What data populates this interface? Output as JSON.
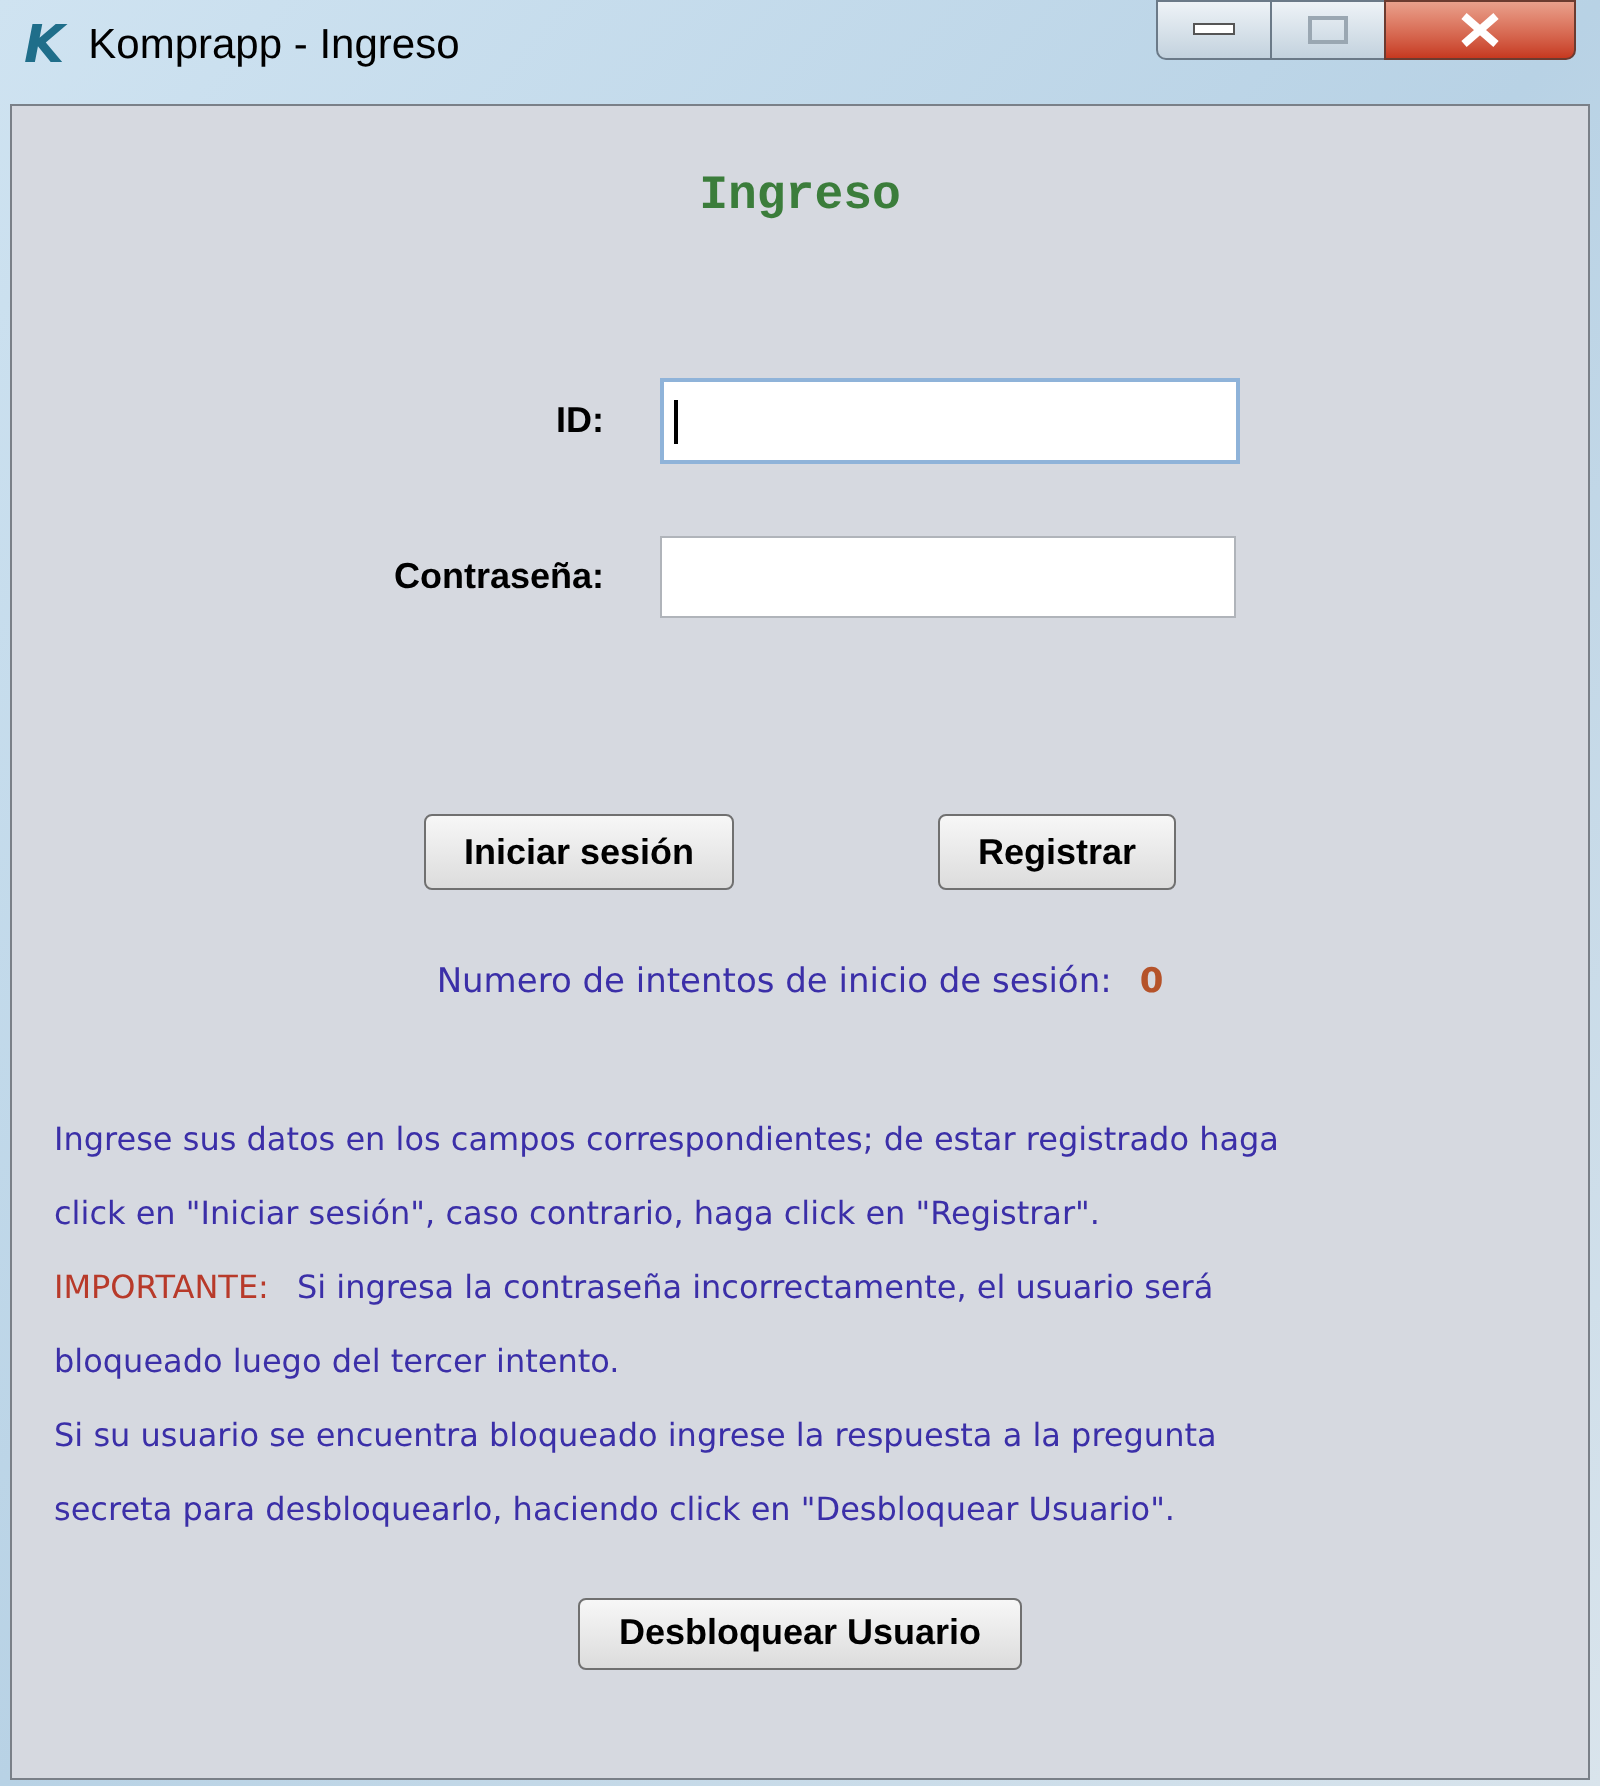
{
  "window": {
    "title": "Komprapp - Ingreso",
    "app_letter": "K"
  },
  "heading": "Ingreso",
  "fields": [
    {
      "label": "ID:",
      "focused": true
    },
    {
      "label": "Contraseña:",
      "focused": false
    }
  ],
  "buttons": [
    "Iniciar sesión",
    "Registrar"
  ],
  "attempts": {
    "label": "Numero de intentos de inicio de sesión:",
    "count": "0"
  },
  "info_lines": [
    {
      "kind": "plain",
      "text": "Ingrese sus datos en los campos correspondientes; de estar registrado haga"
    },
    {
      "kind": "plain",
      "text": "click en \"Iniciar sesión\", caso contrario, haga click en \"Registrar\"."
    },
    {
      "kind": "warning",
      "label": "IMPORTANTE:",
      "text": "Si ingresa la contraseña incorrectamente, el usuario será"
    },
    {
      "kind": "plain",
      "text": "bloqueado luego del tercer intento."
    },
    {
      "kind": "plain",
      "text": "Si su usuario se encuentra bloqueado ingrese la respuesta a la pregunta"
    },
    {
      "kind": "plain",
      "text": "secreta para desbloquearlo, haciendo click en \"Desbloquear Usuario\"."
    }
  ],
  "unlock_button": "Desbloquear Usuario"
}
